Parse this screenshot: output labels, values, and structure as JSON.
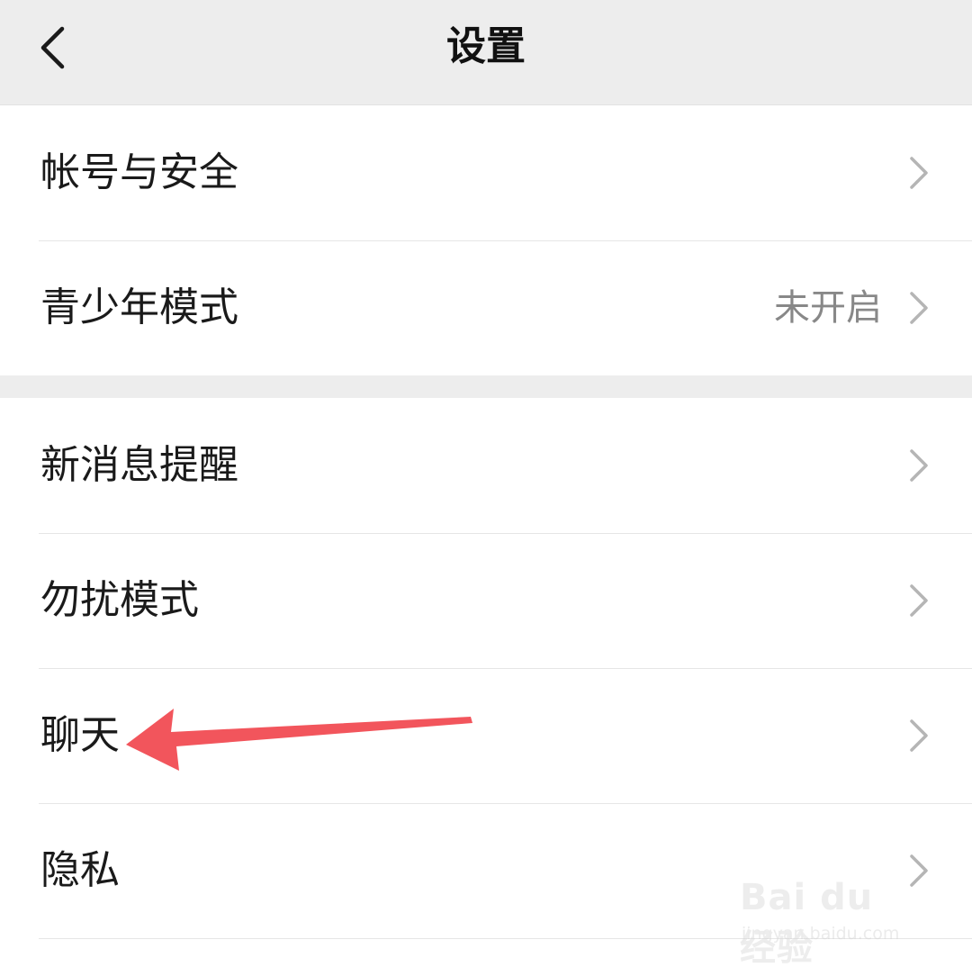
{
  "header": {
    "title": "设置",
    "back_icon": "chevron-left-icon"
  },
  "groups": [
    {
      "items": [
        {
          "label": "帐号与安全",
          "value": ""
        },
        {
          "label": "青少年模式",
          "value": "未开启"
        }
      ]
    },
    {
      "items": [
        {
          "label": "新消息提醒",
          "value": ""
        },
        {
          "label": "勿扰模式",
          "value": ""
        },
        {
          "label": "聊天",
          "value": ""
        },
        {
          "label": "隐私",
          "value": ""
        }
      ]
    }
  ],
  "annotation": {
    "arrow_color": "#f2555c",
    "points_to": "聊天"
  },
  "watermark": {
    "logo": "Bai du 经验",
    "url": "jingyan.baidu.com"
  },
  "colors": {
    "background": "#ededed",
    "row_background": "#ffffff",
    "chevron": "#b5b5b5",
    "secondary_text": "#888888"
  }
}
